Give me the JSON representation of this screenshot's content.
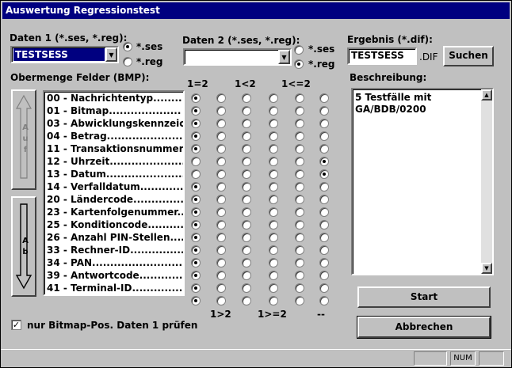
{
  "window": {
    "title": "Auswertung Regressionstest"
  },
  "daten1": {
    "label": "Daten 1 (*.ses, *.reg):",
    "value": "TESTSESS",
    "opt_ses": "*.ses",
    "opt_reg": "*.reg",
    "selected": "ses"
  },
  "daten2": {
    "label": "Daten 2 (*.ses, *.reg):",
    "value": "",
    "opt_ses": "*.ses",
    "opt_reg": "*.reg",
    "selected": "reg"
  },
  "ergebnis": {
    "label": "Ergebnis (*.dif):",
    "value": "TESTSESS",
    "ext": ".DIF",
    "search_button": "Suchen"
  },
  "obermenge": {
    "label": "Obermenge Felder (BMP):"
  },
  "auf_button": {
    "label": "A u f"
  },
  "ab_button": {
    "label": "A b"
  },
  "fields": [
    "00 - Nachrichtentyp........",
    "01 - Bitmap....................",
    "03 - Abwicklungskennzeich",
    "04 - Betrag......................",
    "11 - Transaktionsnummer..",
    "12 - Uhrzeit.....................",
    "13 - Datum......................",
    "14 - Verfalldatum..............",
    "20 - Ländercode...............",
    "23 - Kartenfolgenummer....",
    "25 - Konditioncode...........",
    "26 - Anzahl PIN-Stellen.....",
    "33 - Rechner-ID................",
    "34 - PAN..........................",
    "39 - Antwortcode..............",
    "41 - Terminal-ID..............."
  ],
  "ops_top": [
    "1=2",
    "1<2",
    "1<=2"
  ],
  "ops_bottom": [
    "1>2",
    "1>=2",
    "--"
  ],
  "selection": [
    0,
    0,
    0,
    0,
    0,
    5,
    5,
    0,
    0,
    0,
    0,
    0,
    0,
    0,
    0,
    0,
    0
  ],
  "checkbox": {
    "label": "nur Bitmap-Pos. Daten 1 prüfen",
    "checked": true,
    "mark": "✓"
  },
  "beschreibung": {
    "label": "Beschreibung:",
    "text_line1": "5 Testfälle mit",
    "text_line2": "GA/BDB/0200"
  },
  "buttons": {
    "start": "Start",
    "abbrechen": "Abbrechen"
  },
  "statusbar": {
    "num": "NUM"
  }
}
